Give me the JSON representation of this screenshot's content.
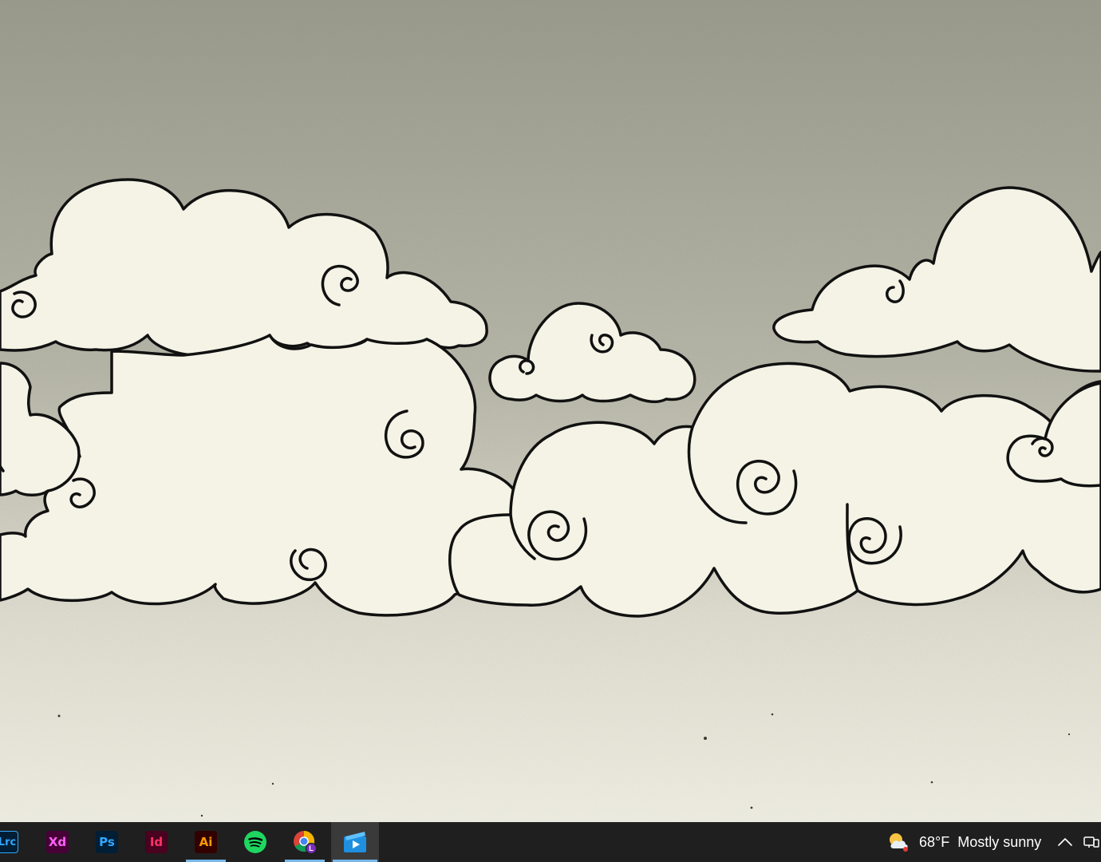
{
  "wallpaper": {
    "name": "cloud-illustration-wallpaper",
    "colors": {
      "sky_top": "#9c9c8e",
      "sky_bottom": "#ebebdf",
      "cloud_fill": "#f4f3e6",
      "outline": "#111111"
    }
  },
  "taskbar": {
    "background": "#1f1f1f",
    "apps": [
      {
        "id": "lightroom",
        "label": "Lrc",
        "icon": "lightroom-classic-icon",
        "bg": "#001e36",
        "fg": "#31a8ff",
        "active": false
      },
      {
        "id": "xd",
        "label": "Xd",
        "icon": "adobe-xd-icon",
        "bg": "#470137",
        "fg": "#ff61f6",
        "active": false
      },
      {
        "id": "photoshop",
        "label": "Ps",
        "icon": "photoshop-icon",
        "bg": "#001e36",
        "fg": "#31a8ff",
        "active": false
      },
      {
        "id": "indesign",
        "label": "Id",
        "icon": "indesign-icon",
        "bg": "#49021f",
        "fg": "#ff3366",
        "active": false
      },
      {
        "id": "illustrator",
        "label": "Ai",
        "icon": "illustrator-icon",
        "bg": "#330000",
        "fg": "#ff9a00",
        "active": true
      },
      {
        "id": "spotify",
        "label": "",
        "icon": "spotify-icon",
        "bg": "#1ed760",
        "fg": "#000000",
        "active": false
      },
      {
        "id": "chrome",
        "label": "L",
        "icon": "chrome-icon",
        "bg": "",
        "fg": "#ffffff",
        "active": true
      },
      {
        "id": "media",
        "label": "",
        "icon": "media-player-icon",
        "bg": "#1f8fe0",
        "fg": "#ffffff",
        "active": true
      }
    ],
    "tray": {
      "weather_icon": "sun-cloud-icon",
      "temperature": "68°F",
      "condition": "Mostly sunny",
      "chevron_icon": "chevron-up-icon",
      "notification_icon": "notification-icon"
    }
  }
}
